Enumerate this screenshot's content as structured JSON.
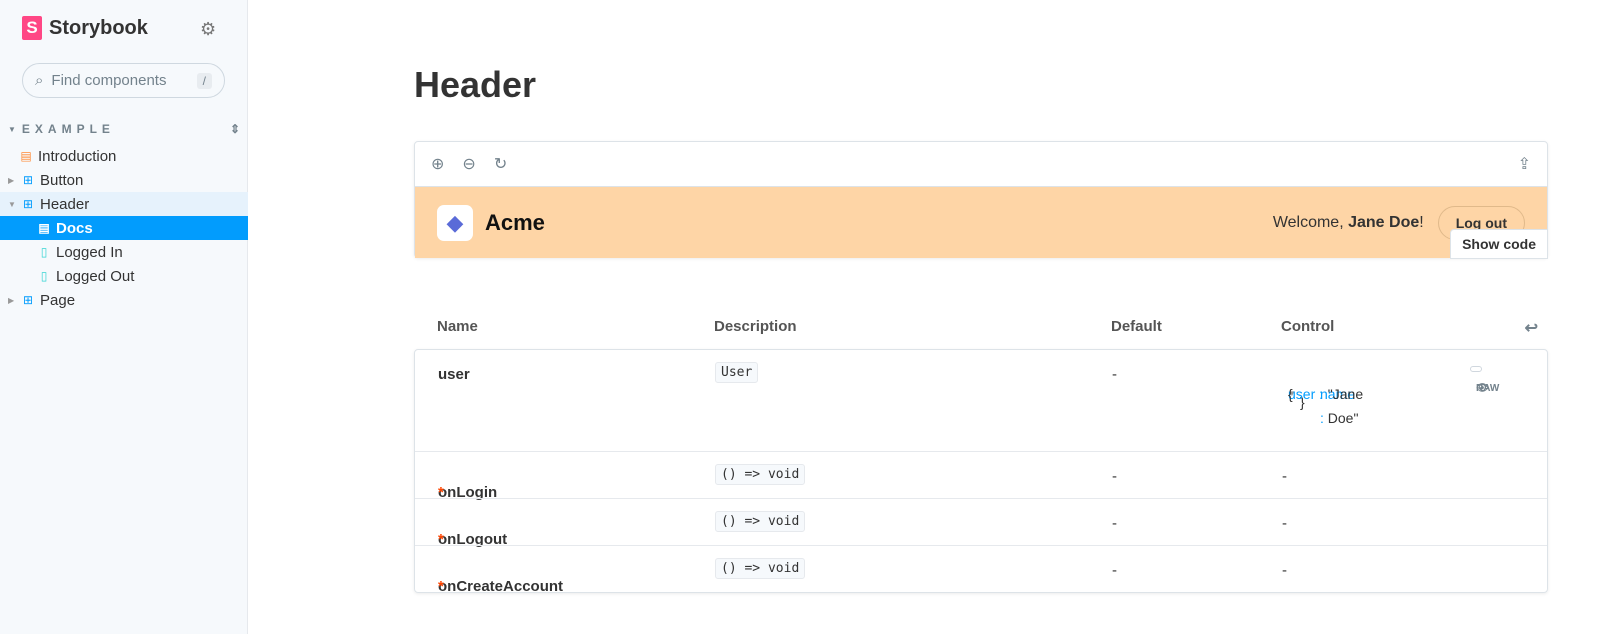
{
  "sidebar": {
    "brand": "Storybook",
    "search_placeholder": "Find components",
    "search_shortcut": "/",
    "group": "EXAMPLE",
    "items": [
      {
        "label": "Introduction",
        "icon": "document-icon",
        "color": "#ff8b38"
      },
      {
        "label": "Button",
        "icon": "component-icon"
      },
      {
        "label": "Header",
        "icon": "component-icon"
      },
      {
        "label": "Docs",
        "icon": "document-icon"
      },
      {
        "label": "Logged In",
        "icon": "bookmark-icon"
      },
      {
        "label": "Logged Out",
        "icon": "bookmark-icon"
      },
      {
        "label": "Page",
        "icon": "component-icon"
      }
    ]
  },
  "main": {
    "title": "Header",
    "preview": {
      "brand": "Acme",
      "welcome_prefix": "Welcome, ",
      "user": "Jane Doe",
      "welcome_suffix": "!",
      "logout": "Log out",
      "show_code": "Show code",
      "bg_color": "#fed5a6"
    },
    "table": {
      "headers": [
        "Name",
        "Description",
        "Default",
        "Control"
      ],
      "rows": [
        {
          "name": "user",
          "required": "",
          "type": "User",
          "default": "-",
          "control": ""
        },
        {
          "name": "onLogin",
          "required": "*",
          "type": "() => void",
          "default": "-",
          "control": "-"
        },
        {
          "name": "onLogout",
          "required": "*",
          "type": "() => void",
          "default": "-",
          "control": "-"
        },
        {
          "name": "onCreateAccount",
          "required": "*",
          "type": "() => void",
          "default": "-",
          "control": "-"
        }
      ],
      "json": {
        "key": "user :",
        "open": "{",
        "name_key": "name :",
        "name_val": "\"Jane Doe\"",
        "close": "}"
      },
      "raw": "RAW"
    }
  },
  "colors": {
    "accent": "#029cfd",
    "brand": "#ff4785"
  }
}
